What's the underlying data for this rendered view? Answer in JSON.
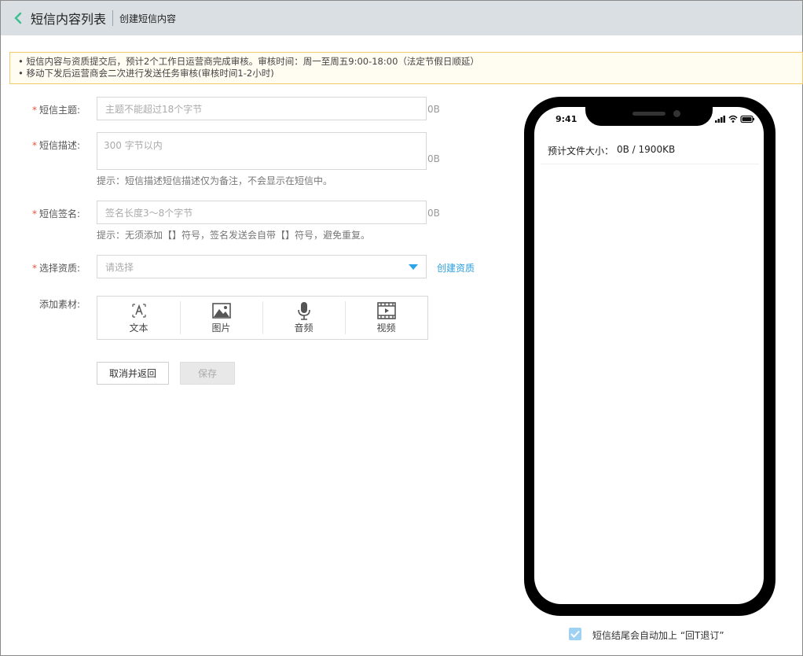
{
  "header": {
    "title": "短信内容列表",
    "subtitle": "创建短信内容"
  },
  "notice": {
    "lines": [
      "短信内容与资质提交后，预计2个工作日运营商完成审核。审核时间：周一至周五9:00-18:00（法定节假日顺延）",
      "移动下发后运营商会二次进行发送任务审核(审核时间1-2小时)"
    ]
  },
  "form": {
    "subject": {
      "label": "短信主题:",
      "placeholder": "主题不能超过18个字节",
      "counter": "0B"
    },
    "description": {
      "label": "短信描述:",
      "placeholder": "300 字节以内",
      "counter": "0B",
      "hint": "提示：短信描述短信描述仅为备注，不会显示在短信中。"
    },
    "signature": {
      "label": "短信签名:",
      "placeholder": "签名长度3～8个字节",
      "counter": "0B",
      "hint": "提示：无须添加【】符号，签名发送会自带【】符号，避免重复。"
    },
    "qualification": {
      "label": "选择资质:",
      "placeholder": "请选择",
      "create_link": "创建资质"
    },
    "material": {
      "label": "添加素材:",
      "items": [
        {
          "label": "文本",
          "icon": "text-icon"
        },
        {
          "label": "图片",
          "icon": "image-icon"
        },
        {
          "label": "音频",
          "icon": "microphone-icon"
        },
        {
          "label": "视频",
          "icon": "video-icon"
        }
      ]
    },
    "required_mark": "*",
    "cancel_label": "取消并返回",
    "save_label": "保存"
  },
  "phone": {
    "time": "9:41",
    "file_size_label": "预计文件大小：",
    "file_size_value": "0B / 1900KB"
  },
  "auto_append": {
    "checked": true,
    "label": "短信结尾会自动加上 “回T退订”"
  },
  "colors": {
    "accent": "#2a9fe0",
    "back_arrow": "#3bbf8f",
    "required": "#e5533d",
    "header_bg": "#d9dfe3"
  }
}
